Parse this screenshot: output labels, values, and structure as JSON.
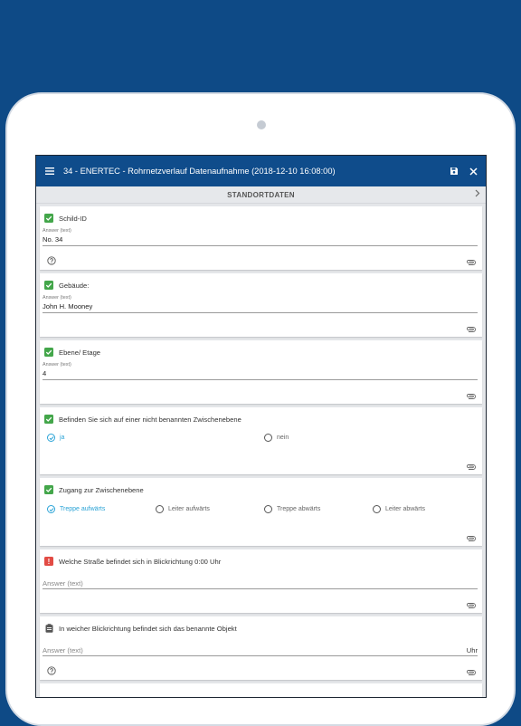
{
  "appbar": {
    "title": "34 - ENERTEC - Rohrnetzverlauf Datenaufnahme (2018-12-10 16:08:00)",
    "icons": [
      "menu-icon",
      "save-icon",
      "close-icon"
    ]
  },
  "section": {
    "title": "STANDORTDATEN"
  },
  "colors": {
    "brand": "#0f4c8b",
    "accent": "#2aa3d6",
    "ok": "#43a64a",
    "error": "#e24b44"
  },
  "questions": [
    {
      "label": "Schild-ID",
      "status": "answered",
      "answer_label": "Answer (text)",
      "answer": "No. 34",
      "help": true
    },
    {
      "label": "Gebäude:",
      "status": "answered",
      "answer_label": "Answer (text)",
      "answer": "John H. Mooney"
    },
    {
      "label": "Ebene/ Etage",
      "status": "answered",
      "answer_label": "Answer (text)",
      "answer": "4"
    },
    {
      "label": "Befinden Sie sich auf einer nicht benannten Zwischenebene",
      "status": "answered",
      "options": [
        "ja",
        "nein"
      ],
      "selected": "ja"
    },
    {
      "label": "Zugang zur Zwischenebene",
      "status": "answered",
      "options": [
        "Treppe aufwärts",
        "Leiter aufwärts",
        "Treppe abwärts",
        "Leiter abwärts"
      ],
      "selected": "Treppe aufwärts"
    },
    {
      "label": "Welche Straße befindet sich in Blickrichtung 0:00 Uhr",
      "status": "error",
      "placeholder": "Answer (text)"
    },
    {
      "label": "In weicher Blickrichtung befindet sich das benannte Objekt",
      "status": "pending",
      "placeholder": "Answer (text)",
      "unit": "Uhr",
      "help": true
    }
  ]
}
